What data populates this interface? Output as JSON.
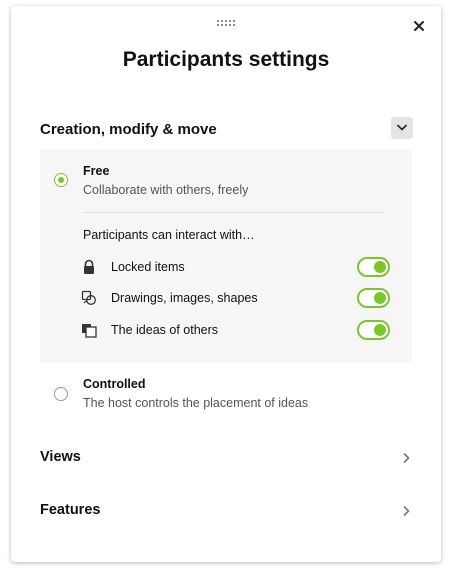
{
  "dialog": {
    "title": "Participants settings",
    "close_icon": "close-icon",
    "drag_handle_icon": "drag-handle-icon"
  },
  "creation": {
    "section_title": "Creation, modify & move",
    "collapse_icon": "chevron-down-icon",
    "options": [
      {
        "label": "Free",
        "description": "Collaborate with others, freely",
        "selected": true
      },
      {
        "label": "Controlled",
        "description": "The host controls the placement of ideas",
        "selected": false
      }
    ],
    "interact_heading": "Participants can interact with…",
    "permissions": [
      {
        "icon": "lock-icon",
        "label": "Locked items",
        "enabled": true
      },
      {
        "icon": "shapes-icon",
        "label": "Drawings, images, shapes",
        "enabled": true
      },
      {
        "icon": "ideas-icon",
        "label": "The ideas of others",
        "enabled": true
      }
    ]
  },
  "sections": [
    {
      "label": "Views",
      "icon": "chevron-right-icon"
    },
    {
      "label": "Features",
      "icon": "chevron-right-icon"
    }
  ],
  "colors": {
    "accent": "#7cc62a",
    "box_background": "#f6f6f6"
  }
}
